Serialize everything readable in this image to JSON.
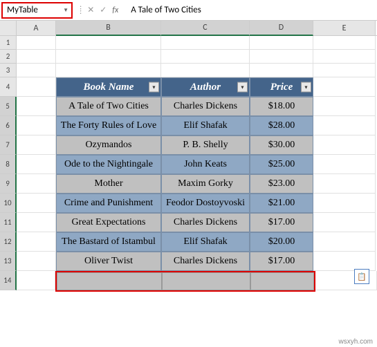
{
  "name_box": "MyTable",
  "formula_value": "A Tale of Two Cities",
  "columns": [
    "A",
    "B",
    "C",
    "D",
    "E"
  ],
  "selected_cols": [
    "B",
    "C",
    "D"
  ],
  "row_numbers": [
    "1",
    "2",
    "3",
    "4",
    "5",
    "6",
    "7",
    "8",
    "9",
    "10",
    "11",
    "12",
    "13",
    "14"
  ],
  "selected_rows": [
    "5",
    "6",
    "7",
    "8",
    "9",
    "10",
    "11",
    "12",
    "13",
    "14"
  ],
  "table": {
    "headers": {
      "book": "Book Name",
      "author": "Author",
      "price": "Price"
    },
    "rows": [
      {
        "book": "A Tale of Two Cities",
        "author": "Charles Dickens",
        "price": "$18.00"
      },
      {
        "book": "The Forty Rules of Love",
        "author": "Elif Shafak",
        "price": "$28.00"
      },
      {
        "book": "Ozymandos",
        "author": "P. B. Shelly",
        "price": "$30.00"
      },
      {
        "book": "Ode to the Nightingale",
        "author": "John Keats",
        "price": "$25.00"
      },
      {
        "book": "Mother",
        "author": "Maxim Gorky",
        "price": "$23.00"
      },
      {
        "book": "Crime and Punishment",
        "author": "Feodor Dostoyvoski",
        "price": "$21.00"
      },
      {
        "book": "Great Expectations",
        "author": "Charles Dickens",
        "price": "$17.00"
      },
      {
        "book": "The Bastard of Istambul",
        "author": "Elif Shafak",
        "price": "$20.00"
      },
      {
        "book": "Oliver Twist",
        "author": "Charles Dickens",
        "price": "$17.00"
      }
    ]
  },
  "watermark": "wsxyh.com"
}
